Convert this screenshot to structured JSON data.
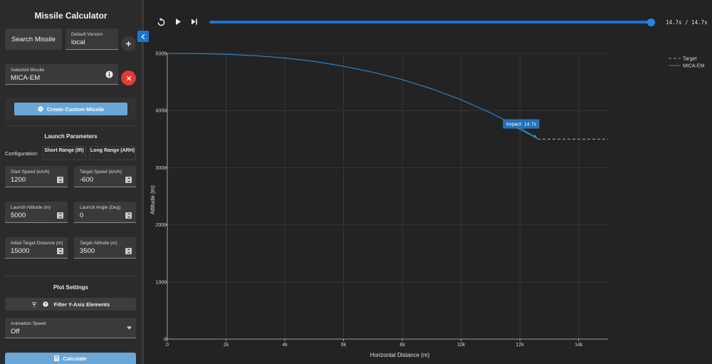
{
  "sidebar": {
    "title": "Missile Calculator",
    "search_missile": "Search Missile",
    "default_version": {
      "label": "Default Version",
      "value": "local"
    },
    "selected_missile": {
      "label": "Selected Missile",
      "value": "MICA-EM"
    },
    "create_custom": "Create Custom Missile",
    "launch_parameters": {
      "title": "Launch Parameters",
      "configuration_label": "Configuration:",
      "config_options": [
        "Short Range (IR)",
        "Long Range (ARH)"
      ],
      "fields": [
        {
          "label": "Start Speed (km/h)",
          "value": "1200"
        },
        {
          "label": "Target Speed (km/h)",
          "value": "-600"
        },
        {
          "label": "Launch Altitude (m)",
          "value": "5000"
        },
        {
          "label": "Launch Angle (Deg)",
          "value": "0"
        },
        {
          "label": "Initial Target Distance (m)",
          "value": "15000"
        },
        {
          "label": "Target Altitude (m)",
          "value": "3500"
        }
      ]
    },
    "plot_settings": {
      "title": "Plot Settings",
      "filter_label": "Filter Y-Axis Elements",
      "animation_speed": {
        "label": "Animation Speed",
        "value": "Off"
      }
    },
    "calculate": "Calculate"
  },
  "player": {
    "time_readout": "14.7s / 14.7s",
    "progress": 1.0
  },
  "icons": {
    "add": "add-icon",
    "info": "info-icon",
    "close": "close-icon",
    "collapse": "chevron-left-icon",
    "replay": "replay-icon",
    "play": "play-icon",
    "skip_end": "skip-end-icon",
    "filter": "filter-icon",
    "dropdown": "chevron-down-icon",
    "calculator": "calculator-icon"
  },
  "colors": {
    "accent": "#1976d2",
    "missile_line": "#2b8cd6",
    "target_line": "#9e9e9e",
    "close_button": "#e53935",
    "calculate_button": "#6aa7d6"
  },
  "chart_data": {
    "type": "line",
    "xlabel": "Horizontal Distance (m)",
    "ylabel": "Altitude (m)",
    "xlim": [
      0,
      15000
    ],
    "ylim": [
      0,
      5000
    ],
    "x_ticks": [
      0,
      2000,
      4000,
      6000,
      8000,
      10000,
      12000,
      14000
    ],
    "x_tick_labels": [
      "0",
      "2k",
      "4k",
      "6k",
      "8k",
      "10k",
      "12k",
      "14k"
    ],
    "y_ticks": [
      0,
      1000,
      2000,
      3000,
      4000,
      5000
    ],
    "y_tick_labels": [
      "0",
      "1000",
      "2000",
      "3000",
      "4000",
      "5000"
    ],
    "grid": true,
    "legend_position": "top-right",
    "series": [
      {
        "name": "Target",
        "style": "dashed",
        "x": [
          12600,
          15000
        ],
        "y": [
          3500,
          3500
        ]
      },
      {
        "name": "MICA-EM",
        "style": "solid",
        "x": [
          0,
          1000,
          2000,
          3000,
          4000,
          5000,
          6000,
          7000,
          8000,
          9000,
          10000,
          11000,
          12000,
          12600
        ],
        "y": [
          5000,
          4998,
          4985,
          4960,
          4920,
          4860,
          4775,
          4670,
          4540,
          4380,
          4190,
          3960,
          3700,
          3510
        ]
      }
    ],
    "annotation": {
      "text": "Impact: 14.7s",
      "x": 12600,
      "y": 3510
    }
  }
}
